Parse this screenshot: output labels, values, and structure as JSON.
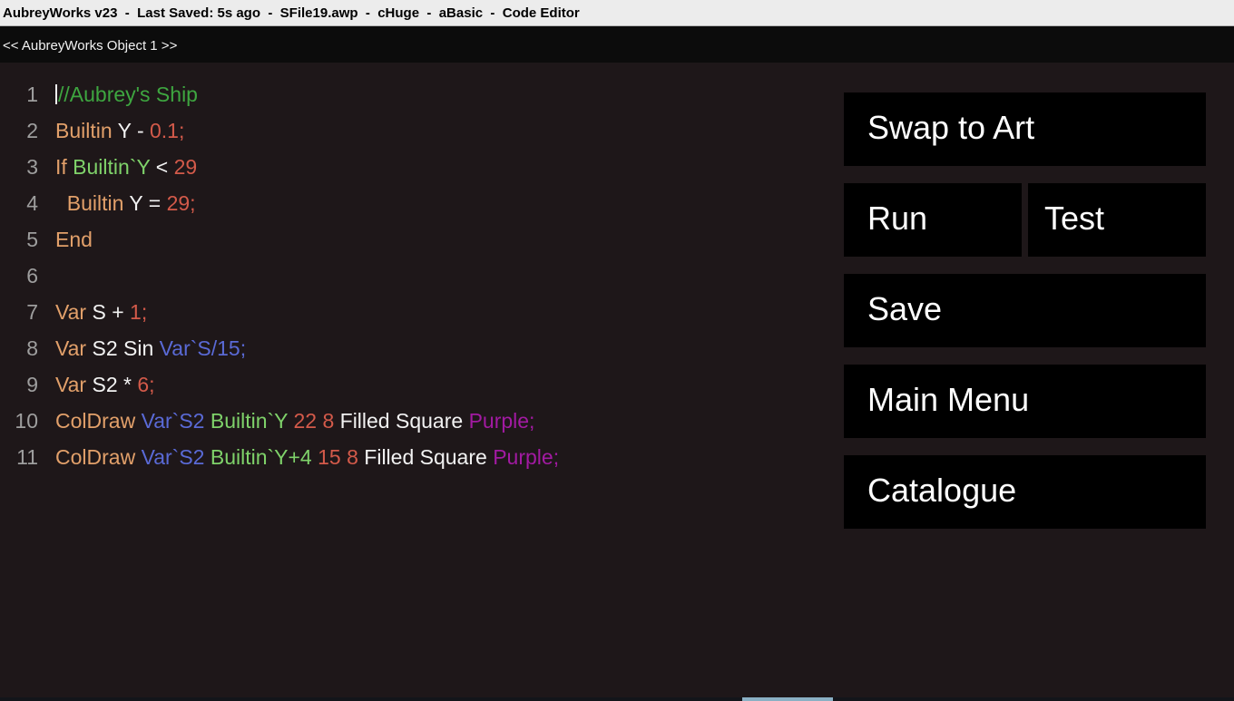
{
  "window": {
    "title": "AubreyWorks v23  -  Last Saved: 5s ago  -  SFile19.awp  -  cHuge  -  aBasic  -  Code Editor"
  },
  "object_header": {
    "label": "<< AubreyWorks Object 1 >>"
  },
  "colors": {
    "comment": "#3ea640",
    "keyword": "#e2a06a",
    "number": "#d35a4a",
    "variable": "#5a6ad6",
    "builtin": "#7fd26a",
    "plain": "#f2f2f2",
    "purple": "#a21aa2"
  },
  "code": {
    "lines": [
      {
        "num": "1",
        "tokens": [
          {
            "t": "//Aubrey's Ship",
            "c": "comment"
          }
        ],
        "caret": true
      },
      {
        "num": "2",
        "tokens": [
          {
            "t": "Builtin",
            "c": "kw"
          },
          {
            "t": " Y - ",
            "c": "plain"
          },
          {
            "t": "0.1;",
            "c": "num"
          }
        ]
      },
      {
        "num": "3",
        "tokens": [
          {
            "t": "If ",
            "c": "kw"
          },
          {
            "t": "Builtin`Y",
            "c": "builtin"
          },
          {
            "t": " < ",
            "c": "plain"
          },
          {
            "t": "29",
            "c": "num"
          }
        ]
      },
      {
        "num": "4",
        "tokens": [
          {
            "t": "  Builtin",
            "c": "kw"
          },
          {
            "t": " Y = ",
            "c": "plain"
          },
          {
            "t": "29;",
            "c": "num"
          }
        ]
      },
      {
        "num": "5",
        "tokens": [
          {
            "t": "End",
            "c": "kw"
          }
        ]
      },
      {
        "num": "6",
        "tokens": []
      },
      {
        "num": "7",
        "tokens": [
          {
            "t": "Var",
            "c": "kw"
          },
          {
            "t": " S + ",
            "c": "plain"
          },
          {
            "t": "1;",
            "c": "num"
          }
        ]
      },
      {
        "num": "8",
        "tokens": [
          {
            "t": "Var",
            "c": "kw"
          },
          {
            "t": " S2 Sin ",
            "c": "plain"
          },
          {
            "t": "Var`S/15;",
            "c": "var"
          }
        ]
      },
      {
        "num": "9",
        "tokens": [
          {
            "t": "Var",
            "c": "kw"
          },
          {
            "t": " S2 * ",
            "c": "plain"
          },
          {
            "t": "6;",
            "c": "num"
          }
        ]
      },
      {
        "num": "10",
        "tokens": [
          {
            "t": "ColDraw ",
            "c": "kw"
          },
          {
            "t": "Var`S2 ",
            "c": "var"
          },
          {
            "t": "Builtin`Y ",
            "c": "builtin"
          },
          {
            "t": "22 8 ",
            "c": "num"
          },
          {
            "t": "Filled Square ",
            "c": "plain"
          },
          {
            "t": "Purple;",
            "c": "purple"
          }
        ]
      },
      {
        "num": "11",
        "tokens": [
          {
            "t": "ColDraw ",
            "c": "kw"
          },
          {
            "t": "Var`S2 ",
            "c": "var"
          },
          {
            "t": "Builtin`Y+4 ",
            "c": "builtin"
          },
          {
            "t": "15 8 ",
            "c": "num"
          },
          {
            "t": "Filled Square ",
            "c": "plain"
          },
          {
            "t": "Purple;",
            "c": "purple"
          }
        ]
      }
    ]
  },
  "buttons": {
    "swap_to_art": "Swap to Art",
    "run": "Run",
    "test": "Test",
    "save": "Save",
    "main_menu": "Main Menu",
    "catalogue": "Catalogue"
  }
}
